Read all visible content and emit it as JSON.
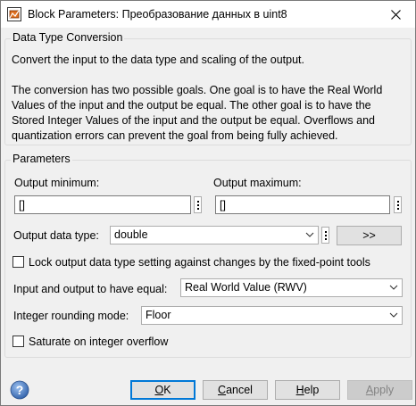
{
  "window": {
    "title": "Block Parameters: Преобразование данных в uint8",
    "app_icon": "simulink-block-icon",
    "close_icon": "close-icon"
  },
  "description": {
    "heading": "Data Type Conversion",
    "lines": [
      "Convert the input to the data type and scaling of the output.",
      "",
      "The conversion has two possible goals. One goal is to have the Real World",
      "Values of the input and the output be equal.  The other goal is to have the",
      "Stored Integer Values of the input and the output be equal.  Overflows and",
      "quantization errors can prevent the goal from being fully achieved."
    ]
  },
  "parameters": {
    "heading": "Parameters",
    "output_minimum": {
      "label": "Output minimum:",
      "value": "[]"
    },
    "output_maximum": {
      "label": "Output maximum:",
      "value": "[]"
    },
    "output_data_type": {
      "label": "Output data type:",
      "value": "double",
      "assistant_button": ">>"
    },
    "lock_checkbox": {
      "label": "Lock output data type setting against changes by the fixed-point tools",
      "checked": false
    },
    "equal_mode": {
      "label": "Input and output to have equal:",
      "value": "Real World Value (RWV)"
    },
    "rounding_mode": {
      "label": "Integer rounding mode:",
      "value": "Floor"
    },
    "saturate_checkbox": {
      "label": "Saturate on integer overflow",
      "checked": false
    }
  },
  "buttons": {
    "ok": {
      "pre": "",
      "mnemonic": "O",
      "post": "K"
    },
    "cancel": {
      "pre": "",
      "mnemonic": "C",
      "post": "ancel"
    },
    "help": {
      "pre": "",
      "mnemonic": "H",
      "post": "elp"
    },
    "apply": {
      "pre": "",
      "mnemonic": "A",
      "post": "pply"
    }
  },
  "colors": {
    "window_bg": "#f0f0f0",
    "titlebar_bg": "#ffffff",
    "default_button_border": "#0078d7",
    "help_icon": "#3e6fb5"
  }
}
